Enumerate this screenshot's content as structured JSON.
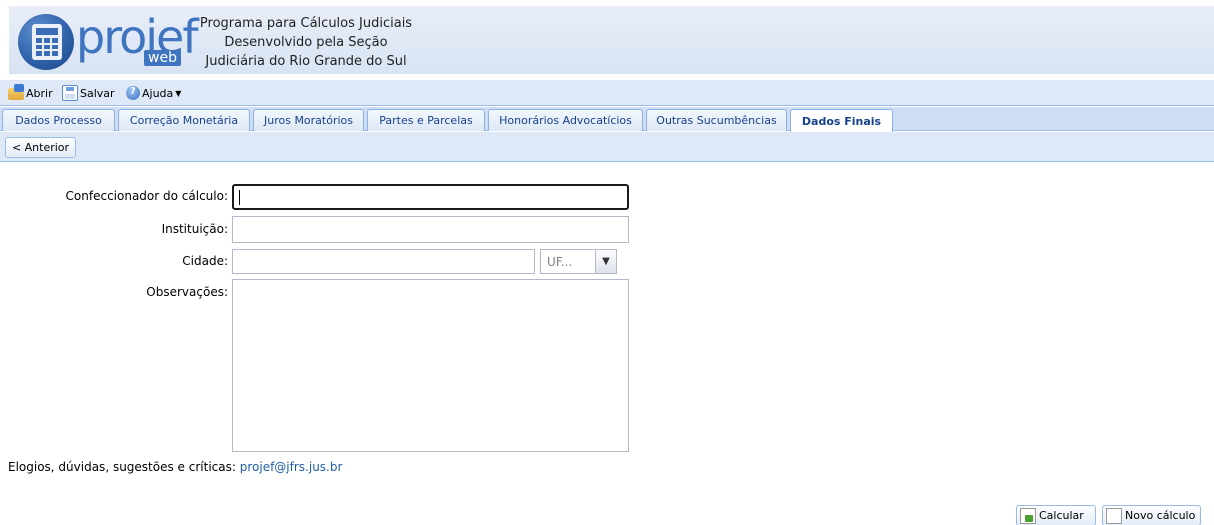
{
  "header": {
    "logo_word": "projef",
    "logo_suffix": "web",
    "title_line1": "Programa para Cálculos Judiciais",
    "title_line2": "Desenvolvido pela Seção",
    "title_line3": "Judiciária do Rio Grande do Sul"
  },
  "toolbar": {
    "open_label": "Abrir",
    "save_label": "Salvar",
    "help_label": "Ajuda"
  },
  "tabs": [
    {
      "label": "Dados Processo"
    },
    {
      "label": "Correção Monetária"
    },
    {
      "label": "Juros Moratórios"
    },
    {
      "label": "Partes e Parcelas"
    },
    {
      "label": "Honorários Advocatícios"
    },
    {
      "label": "Outras Sucumbências"
    },
    {
      "label": "Dados Finais",
      "active": true
    }
  ],
  "nav": {
    "previous_label": "< Anterior"
  },
  "form": {
    "confeccionador_label": "Confeccionador do cálculo:",
    "confeccionador_value": "",
    "instituicao_label": "Instituição:",
    "instituicao_value": "",
    "cidade_label": "Cidade:",
    "cidade_value": "",
    "uf_placeholder": "UF...",
    "observacoes_label": "Observações:",
    "observacoes_value": ""
  },
  "feedback": {
    "text": "Elogios, dúvidas, sugestões e críticas:",
    "email": "projef@jfrs.jus.br"
  },
  "actions": {
    "calcular_label": "Calcular",
    "novo_label": "Novo cálculo"
  },
  "colors": {
    "toolbar_bg": "#dfe8f6",
    "tab_text": "#15428b",
    "link": "#1f5fa8",
    "logo_blue": "#3f75c0"
  }
}
